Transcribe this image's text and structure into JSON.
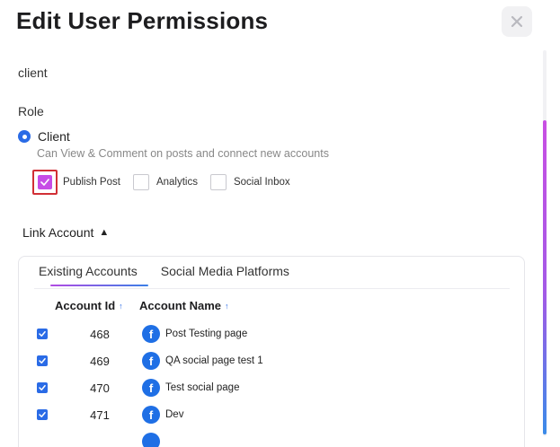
{
  "dialog": {
    "title": "Edit User Permissions",
    "close_icon": "close-icon"
  },
  "user": {
    "name": "client"
  },
  "role": {
    "label": "Role",
    "selected": "Client",
    "description": "Can View & Comment on posts and connect new accounts"
  },
  "permissions": [
    {
      "label": "Publish Post",
      "checked": true
    },
    {
      "label": "Analytics",
      "checked": false
    },
    {
      "label": "Social Inbox",
      "checked": false
    }
  ],
  "link_account": {
    "label": "Link Account",
    "caret": "▲"
  },
  "tabs": [
    {
      "label": "Existing Accounts",
      "active": true
    },
    {
      "label": "Social Media Platforms",
      "active": false
    }
  ],
  "table": {
    "columns": [
      {
        "label": "Account Id",
        "sort": "↑"
      },
      {
        "label": "Account Name",
        "sort": "↑"
      }
    ],
    "rows": [
      {
        "id": "468",
        "name": "Post Testing page",
        "checked": true,
        "icon": "facebook-icon"
      },
      {
        "id": "469",
        "name": "QA social page test 1",
        "checked": true,
        "icon": "facebook-icon"
      },
      {
        "id": "470",
        "name": "Test social page",
        "checked": true,
        "icon": "facebook-icon"
      },
      {
        "id": "471",
        "name": "Dev",
        "checked": true,
        "icon": "facebook-icon"
      }
    ]
  },
  "colors": {
    "accent_blue": "#2a6be6",
    "accent_purple": "#c74ce6",
    "highlight_red": "#d12f35",
    "facebook_blue": "#1f6fe5"
  }
}
